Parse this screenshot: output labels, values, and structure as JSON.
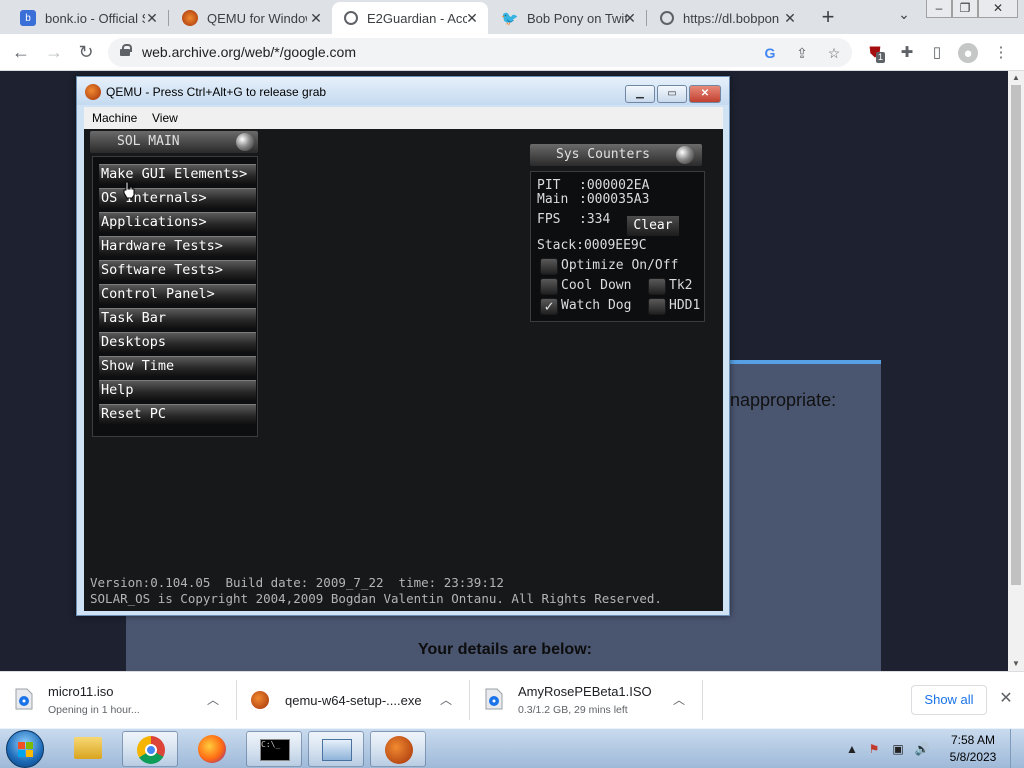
{
  "browser": {
    "tabs": [
      {
        "label": "bonk.io - Official S",
        "icon": "bonk-icon",
        "active": false
      },
      {
        "label": "QEMU for Windows",
        "icon": "qemu-icon",
        "active": false
      },
      {
        "label": "E2Guardian - Acc",
        "icon": "globe-icon",
        "active": true
      },
      {
        "label": "Bob Pony on Twit",
        "icon": "twitter-icon",
        "active": false
      },
      {
        "label": "https://dl.bobpon",
        "icon": "globe-icon",
        "active": false
      }
    ],
    "url": "web.archive.org/web/*/google.com",
    "extension_badge": "1"
  },
  "webpage": {
    "inappropriate_text": "nappropriate:",
    "details_text": "Your details are below:"
  },
  "qemu": {
    "title": "QEMU - Press Ctrl+Alt+G to release grab",
    "menu": [
      "Machine",
      "View"
    ],
    "sol_main": {
      "title": "SOL MAIN",
      "items": [
        "Make GUI Elements>",
        "OS Internals>",
        "Applications>",
        "Hardware Tests>",
        "Software Tests>",
        "Control Panel>",
        "Task Bar",
        "Desktops",
        "Show Time",
        "Help",
        "Reset PC"
      ]
    },
    "sys_counters": {
      "title": "Sys Counters",
      "pit_label": "PIT",
      "pit_value": ":000002EA",
      "main_label": "Main",
      "main_value": ":000035A3",
      "fps_label": "FPS",
      "fps_value": ":334",
      "clear_label": "Clear",
      "stack": "Stack:0009EE9C",
      "checks": [
        {
          "label": "Optimize On/Off",
          "checked": false
        },
        {
          "label": "Cool Down",
          "checked": false
        },
        {
          "label": "Tk2",
          "checked": false
        },
        {
          "label": "Watch Dog",
          "checked": true
        },
        {
          "label": "HDD1",
          "checked": false
        }
      ]
    },
    "footer": {
      "line1": "Version:0.104.05  Build date: 2009_7_22  time: 23:39:12",
      "line2": "SOLAR_OS is Copyright 2004,2009 Bogdan Valentin Ontanu. All Rights Reserved."
    }
  },
  "downloads": [
    {
      "name": "micro11.iso",
      "status": "Opening in 1 hour...",
      "icon": "disc-icon"
    },
    {
      "name": "qemu-w64-setup-....exe",
      "status": "",
      "icon": "qemu-icon"
    },
    {
      "name": "AmyRosePEBeta1.ISO",
      "status": "0.3/1.2 GB, 29 mins left",
      "icon": "disc-icon"
    }
  ],
  "show_all_label": "Show all",
  "taskbar": {
    "time": "7:58 AM",
    "date": "5/8/2023"
  },
  "colors": {
    "accent": "#1a73e8",
    "qemu_screen": "#16181a",
    "webpage_bg": "#1d2130"
  }
}
